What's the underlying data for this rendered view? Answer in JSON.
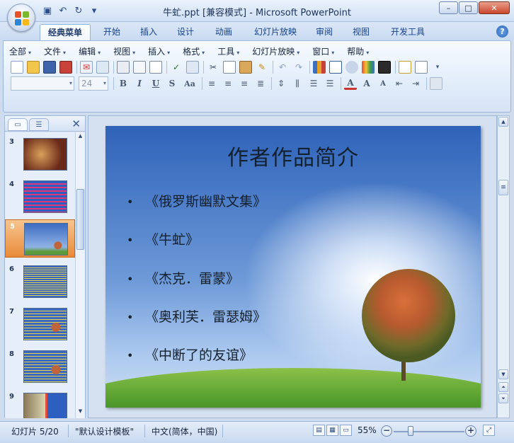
{
  "window": {
    "title": "牛虻.ppt [兼容模式] - Microsoft PowerPoint",
    "controls": [
      "–",
      "□",
      "✕"
    ]
  },
  "qat": {
    "icons": [
      "save-icon",
      "undo-icon",
      "redo-icon",
      "customize-icon"
    ],
    "glyphs": [
      "▣",
      "↶",
      "↻",
      "▾"
    ]
  },
  "ribbon_tabs": [
    "经典菜单",
    "开始",
    "插入",
    "设计",
    "动画",
    "幻灯片放映",
    "审阅",
    "视图",
    "开发工具"
  ],
  "help_label": "?",
  "menus": [
    "全部",
    "文件",
    "编辑",
    "视图",
    "插入",
    "格式",
    "工具",
    "幻灯片放映",
    "窗口",
    "帮助"
  ],
  "font_size_value": "24",
  "format_glyphs": [
    "B",
    "I",
    "U",
    "S",
    "Aa"
  ],
  "left_panel": {
    "close_glyph": "✕",
    "slides": [
      {
        "number": "3",
        "selected": false
      },
      {
        "number": "4",
        "selected": false
      },
      {
        "number": "5",
        "selected": true
      },
      {
        "number": "6",
        "selected": false
      },
      {
        "number": "7",
        "selected": false
      },
      {
        "number": "8",
        "selected": false
      },
      {
        "number": "9",
        "selected": false
      }
    ]
  },
  "slide": {
    "title": "作者作品简介",
    "bullet_char": "•",
    "bullets": [
      "《俄罗斯幽默文集》",
      "《牛虻》",
      "《杰克．雷蒙》",
      "《奥利芙．雷瑟姆》",
      "《中断了的友谊》"
    ]
  },
  "status": {
    "slide_pos": "幻灯片 5/20",
    "template": "\"默认设计模板\"",
    "language": "中文(简体，中国)",
    "zoom": "55%",
    "zoom_minus": "−",
    "zoom_plus": "+"
  },
  "colors": {
    "accent": "#15428b",
    "selected_thumb": "#e98b3a",
    "slide_sky": "#4f7fc7"
  }
}
